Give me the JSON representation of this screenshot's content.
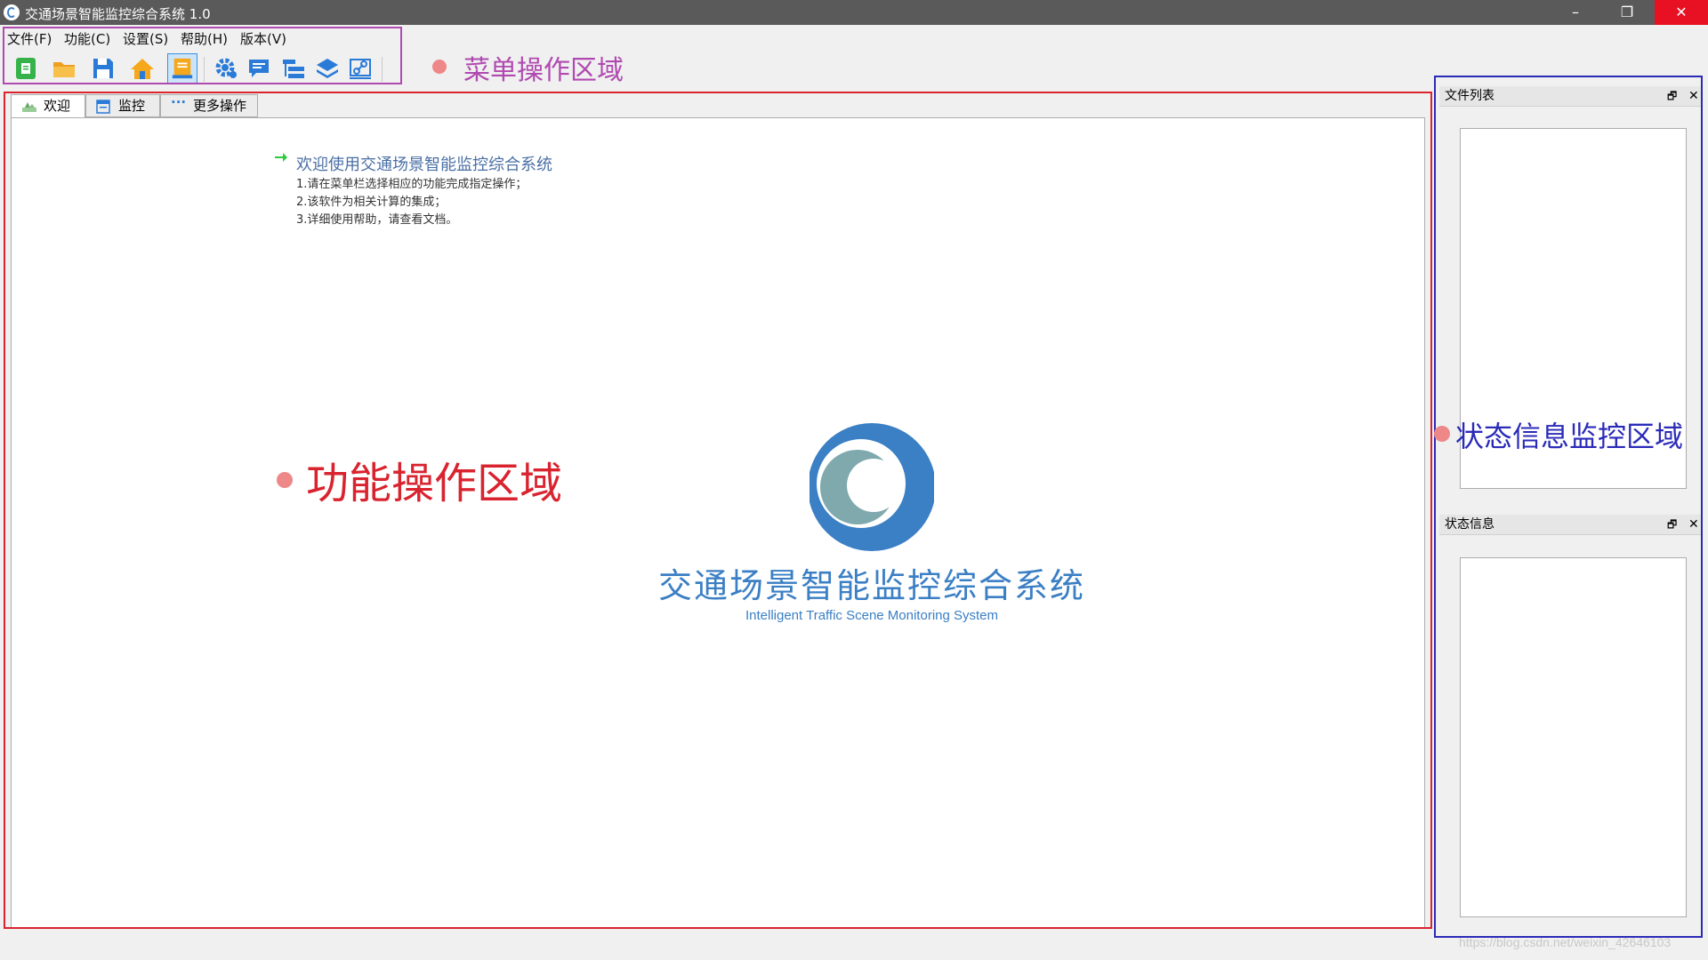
{
  "window": {
    "title": "交通场景智能监控综合系统 1.0",
    "minimize": "–",
    "maximize": "❐",
    "close": "✕"
  },
  "menu": {
    "items": [
      "文件(F)",
      "功能(C)",
      "设置(S)",
      "帮助(H)",
      "版本(V)"
    ]
  },
  "toolbar": {
    "buttons": [
      {
        "icon": "new-document-icon"
      },
      {
        "icon": "open-folder-icon"
      },
      {
        "icon": "save-icon"
      },
      {
        "icon": "home-icon"
      },
      {
        "icon": "dock-panel-icon",
        "active": true
      },
      {
        "icon": "settings-gear-icon"
      },
      {
        "icon": "message-icon"
      },
      {
        "icon": "tree-list-icon"
      },
      {
        "icon": "layers-icon"
      },
      {
        "icon": "link-icon"
      }
    ]
  },
  "annotations": {
    "menu_area": "菜单操作区域",
    "work_area": "功能操作区域",
    "status_area": "状态信息监控区域",
    "colors": {
      "menu": "#b04ab0",
      "work": "#d9232e",
      "status": "#2b2bb8"
    }
  },
  "tabs": [
    {
      "label": "欢迎",
      "icon": "welcome-icon",
      "selected": true
    },
    {
      "label": "监控",
      "icon": "monitor-icon",
      "selected": false
    },
    {
      "label": "更多操作",
      "icon": "more-icon",
      "selected": false
    }
  ],
  "welcome": {
    "title": "欢迎使用交通场景智能监控综合系统",
    "lines": [
      "1.请在菜单栏选择相应的功能完成指定操作；",
      "2.该软件为相关计算的集成；",
      "3.详细使用帮助，请查看文档。"
    ]
  },
  "logo": {
    "cn": "交通场景智能监控综合系统",
    "en": "Intelligent Traffic Scene Monitoring System",
    "color": "#3b7fc4"
  },
  "panels": {
    "file_list": {
      "title": "文件列表",
      "float": "🗗",
      "close": "✕"
    },
    "status_info": {
      "title": "状态信息",
      "float": "🗗",
      "close": "✕"
    }
  },
  "watermark": "https://blog.csdn.net/weixin_42646103"
}
